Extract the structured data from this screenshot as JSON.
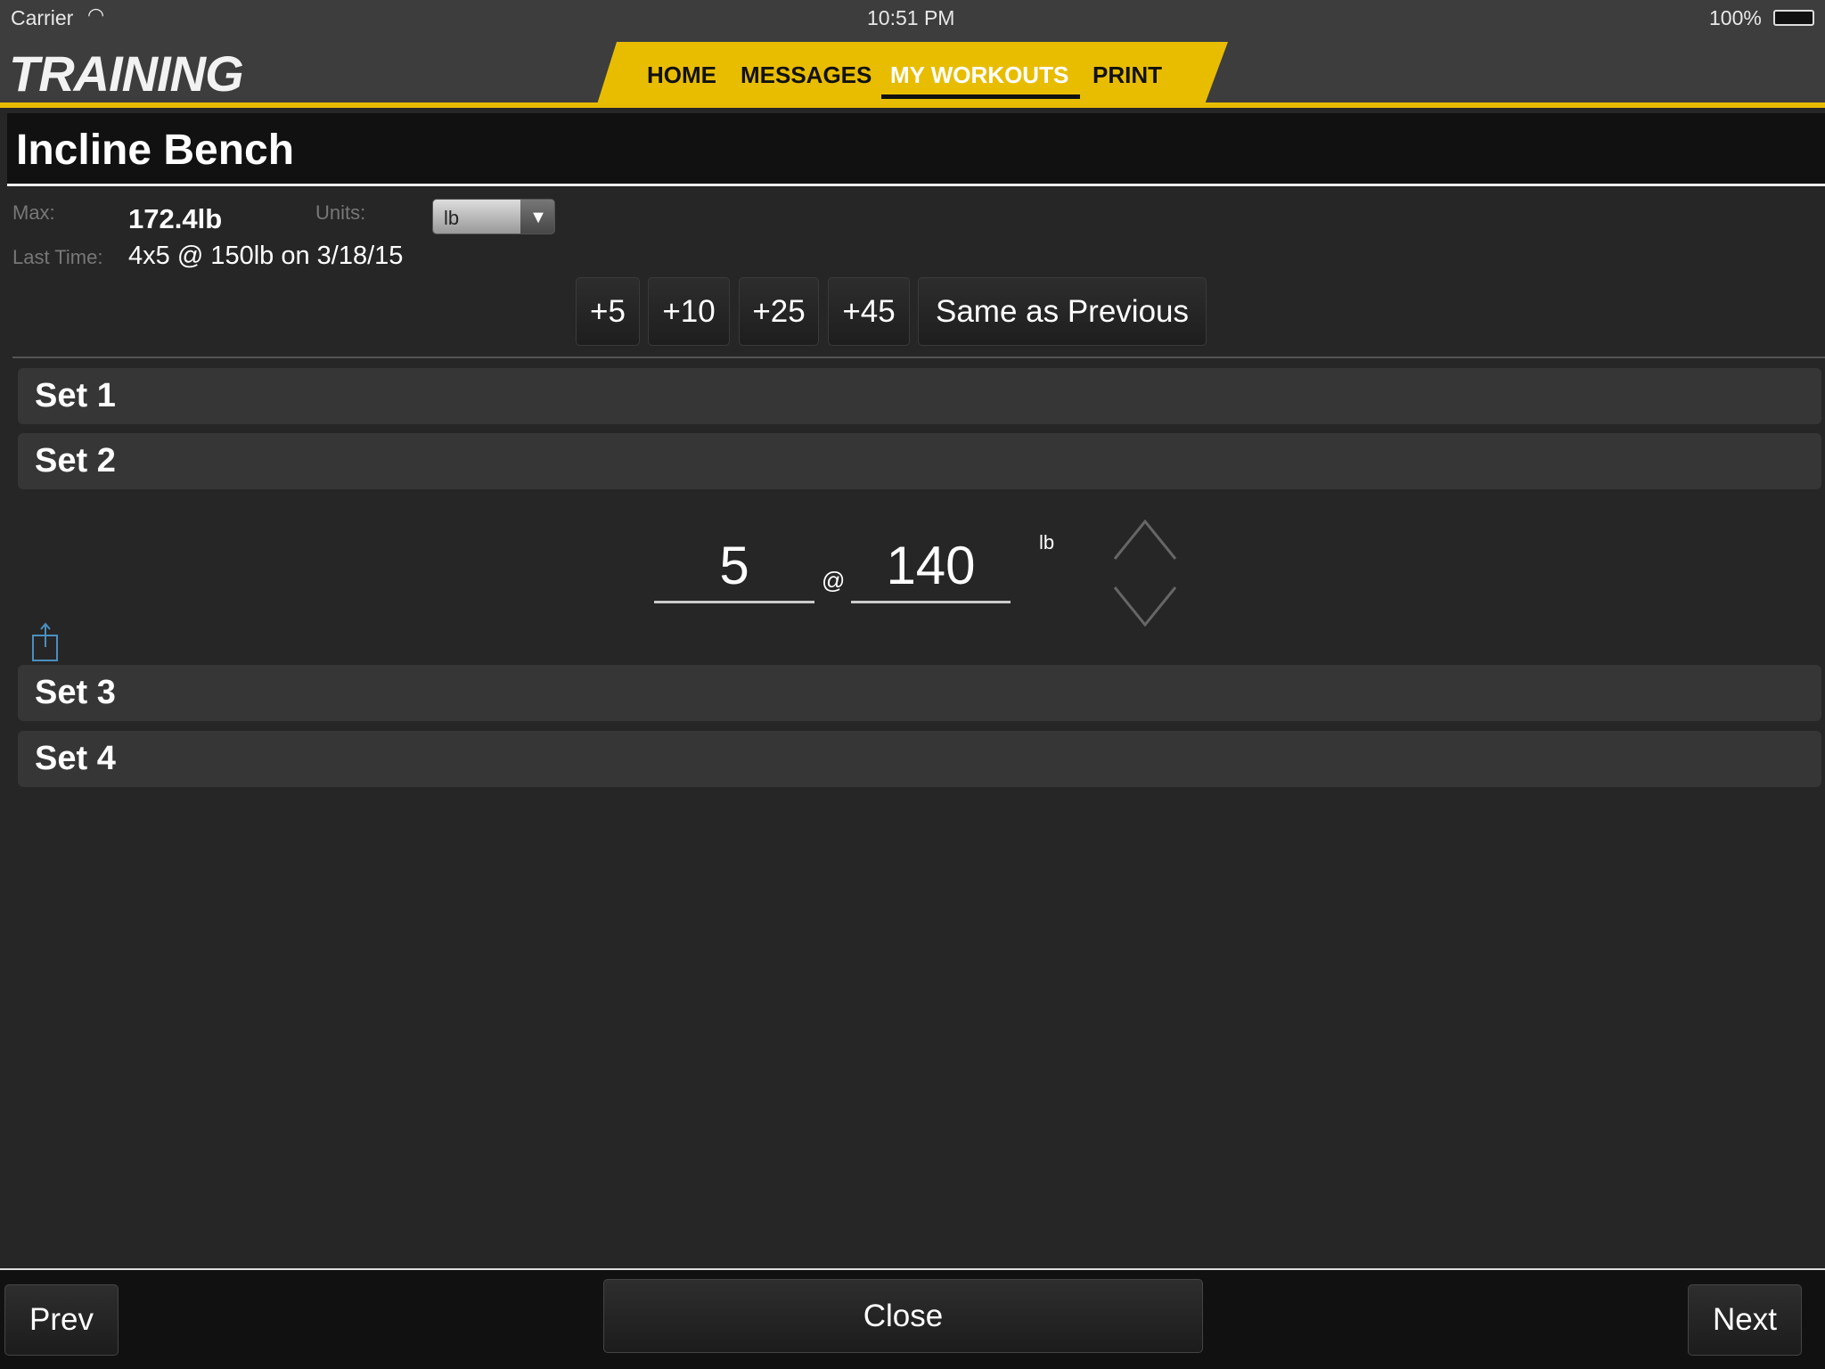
{
  "status_bar": {
    "carrier": "Carrier",
    "time": "10:51 PM",
    "battery": "100%"
  },
  "header": {
    "logo": "TRAINING",
    "nav": [
      {
        "label": "HOME"
      },
      {
        "label": "MESSAGES"
      },
      {
        "label": "MY WORKOUTS",
        "active": true
      },
      {
        "label": "PRINT"
      }
    ],
    "accent": "#e8bd00"
  },
  "exercise": {
    "title": "Incline Bench",
    "max_label": "Max:",
    "max_value": "172.4lb",
    "units_label": "Units:",
    "units_value": "lb",
    "last_label": "Last Time:",
    "last_value": "4x5 @ 150lb on 3/18/15"
  },
  "quick_buttons": [
    "+5",
    "+10",
    "+25",
    "+45",
    "Same as Previous"
  ],
  "sets": [
    {
      "label": "Set 1"
    },
    {
      "label": "Set 2"
    },
    {
      "label": "Set 3"
    },
    {
      "label": "Set 4"
    }
  ],
  "editor": {
    "reps": "5",
    "at": "@",
    "weight": "140",
    "unit": "lb"
  },
  "footer": {
    "prev": "Prev",
    "close": "Close",
    "next": "Next"
  }
}
